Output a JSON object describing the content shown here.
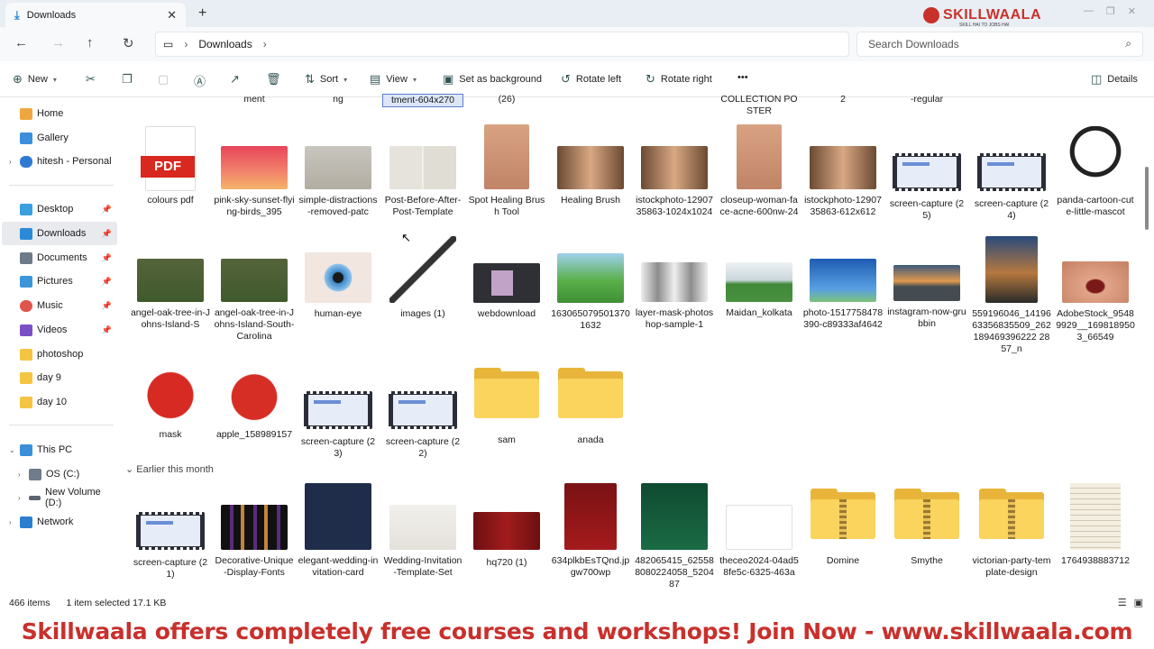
{
  "window": {
    "tab_title": "Downloads",
    "new_tab": "+",
    "close": "✕"
  },
  "brand": {
    "name": "SKILLWAALA",
    "tagline": "SKILL HAI TO JOBS HAI"
  },
  "address": {
    "current_folder": "Downloads",
    "search_placeholder": "Search Downloads"
  },
  "toolbar": {
    "new_label": "New",
    "sort_label": "Sort",
    "view_label": "View",
    "set_bg_label": "Set as background",
    "rotate_left_label": "Rotate left",
    "rotate_right_label": "Rotate right",
    "more_label": "•••",
    "details_label": "Details"
  },
  "sidebar": {
    "items": [
      {
        "label": "Home"
      },
      {
        "label": "Gallery"
      },
      {
        "label": "hitesh - Personal"
      },
      {
        "label": "Desktop"
      },
      {
        "label": "Downloads"
      },
      {
        "label": "Documents"
      },
      {
        "label": "Pictures"
      },
      {
        "label": "Music"
      },
      {
        "label": "Videos"
      },
      {
        "label": "photoshop"
      },
      {
        "label": "day 9"
      },
      {
        "label": "day 10"
      },
      {
        "label": "This PC"
      },
      {
        "label": "OS (C:)"
      },
      {
        "label": "New Volume (D:)"
      },
      {
        "label": "Network"
      }
    ]
  },
  "top_partial": [
    "ment",
    "ng",
    "tment-604x270",
    "(26)",
    "COLLECTION POSTER",
    "2",
    "-regular"
  ],
  "row1": [
    "colours pdf",
    "pink-sky-sunset-flying-birds_395",
    "simple-distractions-removed-patc",
    "Post-Before-After-Post-Template",
    "Spot Healing Brush Tool",
    "Healing Brush",
    "istockphoto-1290735863-1024x1024",
    "closeup-woman-face-acne-600nw-24",
    "istockphoto-1290735863-612x612",
    "screen-capture (25)",
    "screen-capture (24)",
    "panda-cartoon-cute-little-mascot"
  ],
  "row2": [
    "angel-oak-tree-in-Johns-Island-S",
    "angel-oak-tree-in-Johns-Island-South-Carolina",
    "human-eye",
    "images (1)",
    "webdownload",
    "1630650795013701632",
    "layer-mask-photoshop-sample-1",
    "Maidan_kolkata",
    "photo-1517758478390-c89333af4642",
    "instagram-now-grubbin",
    "559196046_1419663356835509_262189469396222 2857_n",
    "AdobeStock_95489929__1698189503_66549"
  ],
  "row3": [
    "mask",
    "apple_158989157",
    "screen-capture (23)",
    "screen-capture (22)",
    "sam",
    "anada"
  ],
  "group_label": "Earlier this month",
  "row4": [
    "screen-capture (21)",
    "Decorative-Unique-Display-Fonts",
    "elegant-wedding-invitation-card",
    "Wedding-Invitation-Template-Set",
    "hq720 (1)",
    "634plkbEsTQnd.jpgw700wp",
    "482065415_625588080224058_520487",
    "theceo2024-04ad58fe5c-6325-463a",
    "Domine",
    "Smythe",
    "victorian-party-template-design",
    "1764938883712"
  ],
  "status": {
    "items": "466 items",
    "selected": "1 item selected  17.1 KB"
  },
  "banner_text": "Skillwaala offers completely free courses and workshops! Join Now  - www.skillwaala.com",
  "colors": {
    "accent": "#2b8ad8",
    "brand_red": "#c9302c",
    "folder": "#fbd45e"
  }
}
